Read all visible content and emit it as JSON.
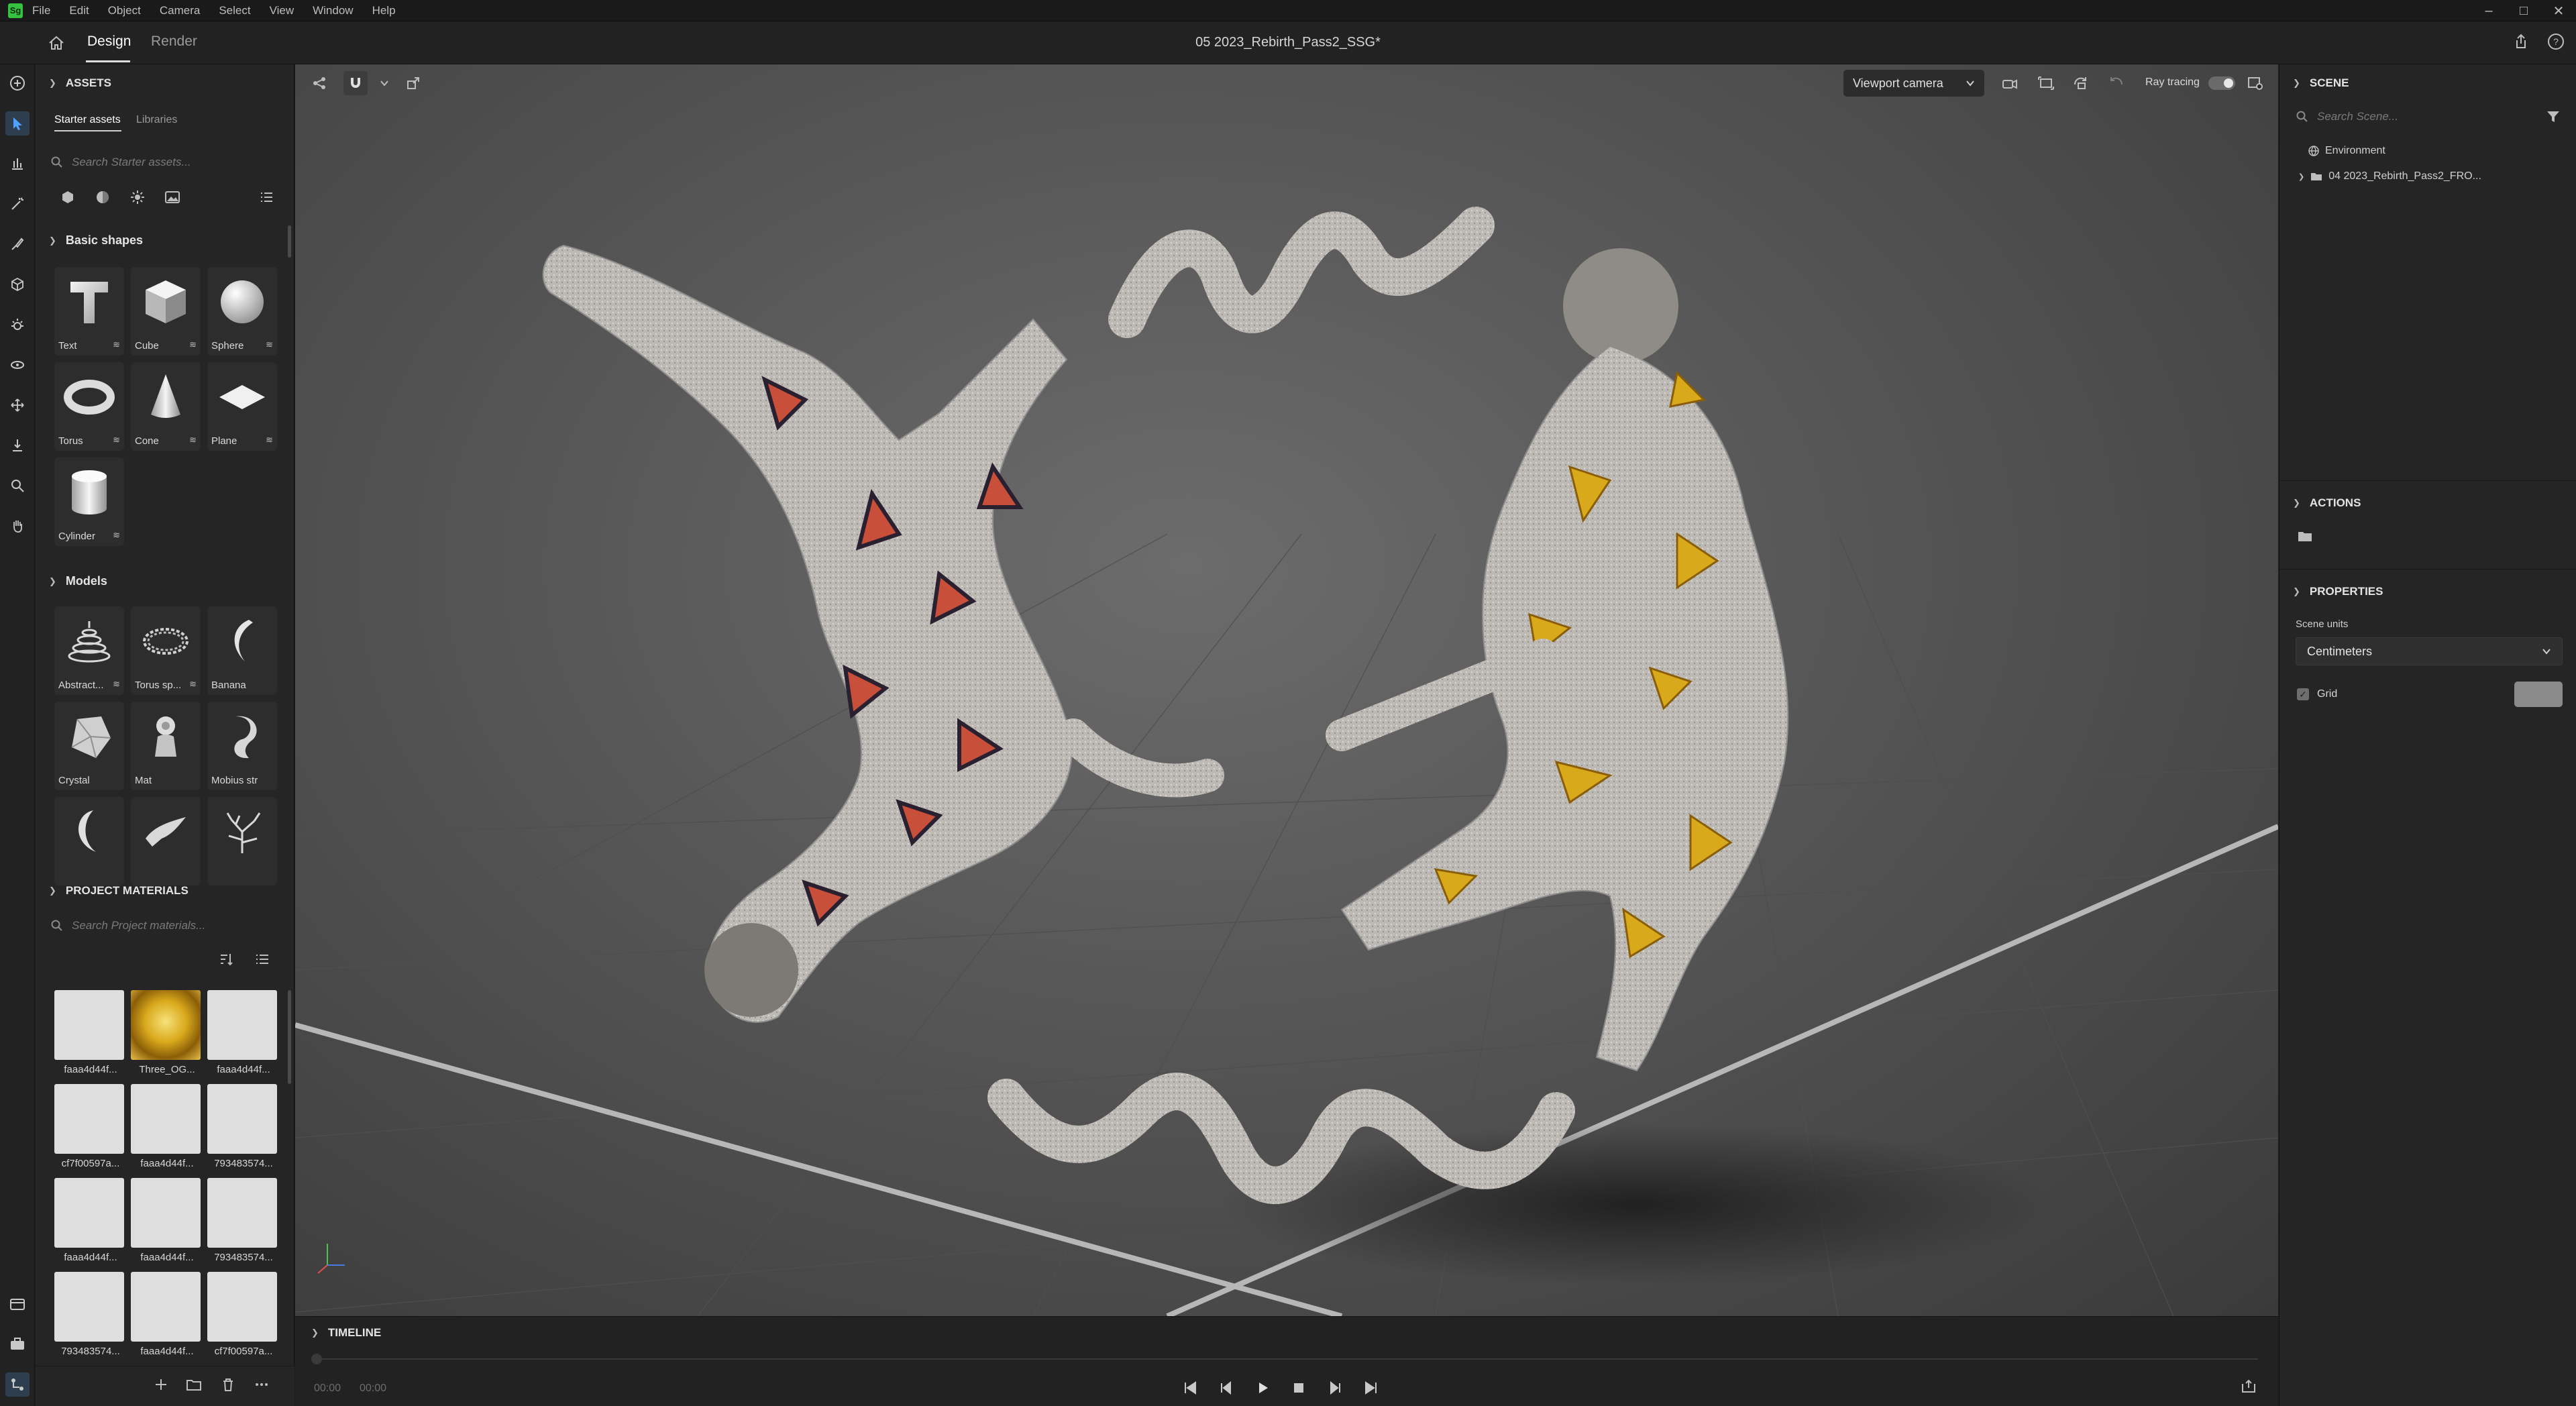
{
  "menubar": {
    "logo": "Sg",
    "items": [
      "File",
      "Edit",
      "Object",
      "Camera",
      "Select",
      "View",
      "Window",
      "Help"
    ]
  },
  "tabbar": {
    "tabs": [
      "Design",
      "Render"
    ],
    "active_tab": "Design",
    "document_title": "05 2023_Rebirth_Pass2_SSG*"
  },
  "assets": {
    "header": "ASSETS",
    "subtabs": [
      "Starter assets",
      "Libraries"
    ],
    "search_placeholder": "Search Starter assets...",
    "basic_shapes": {
      "header": "Basic shapes",
      "items": [
        "Text",
        "Cube",
        "Sphere",
        "Torus",
        "Cone",
        "Plane",
        "Cylinder"
      ]
    },
    "models": {
      "header": "Models",
      "items": [
        "Abstract...",
        "Torus sp...",
        "Banana",
        "Crystal",
        "Mat",
        "Mobius strip",
        "",
        "",
        ""
      ]
    },
    "project_materials": {
      "header": "PROJECT MATERIALS",
      "search_placeholder": "Search Project materials...",
      "items": [
        "faaa4d44f...",
        "Three_OG...",
        "faaa4d44f...",
        "cf7f00597a...",
        "faaa4d44f...",
        "793483574...",
        "faaa4d44f...",
        "faaa4d44f...",
        "793483574...",
        "793483574...",
        "faaa4d44f...",
        "cf7f00597a..."
      ]
    }
  },
  "viewport": {
    "camera": "Viewport camera",
    "ray_tracing_label": "Ray tracing",
    "ray_tracing_on": true
  },
  "timeline": {
    "header": "TIMELINE",
    "time_start": "00:00",
    "time_end": "00:00"
  },
  "scene": {
    "header": "SCENE",
    "search_placeholder": "Search Scene...",
    "tree": [
      "Environment",
      "04 2023_Rebirth_Pass2_FRO..."
    ]
  },
  "actions": {
    "header": "ACTIONS"
  },
  "properties": {
    "header": "PROPERTIES",
    "scene_units_label": "Scene units",
    "scene_units_value": "Centimeters",
    "grid_label": "Grid",
    "grid_enabled": true,
    "grid_color": "#8a8a8a"
  },
  "colors": {
    "accent_green": "#35c23f",
    "panel": "#252525",
    "material_gold": "#d9a91c",
    "material_red": "#c8503a"
  }
}
